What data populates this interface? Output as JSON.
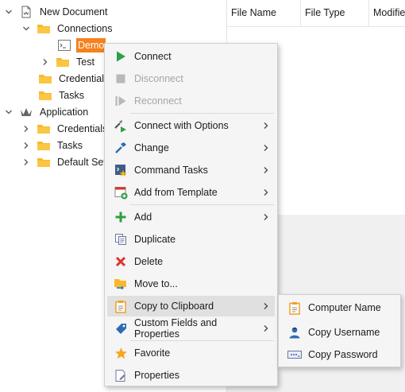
{
  "tree": {
    "items": [
      {
        "label": "New Document"
      },
      {
        "label": "Connections"
      },
      {
        "label": "Demo"
      },
      {
        "label": "Test"
      },
      {
        "label": "Credentials"
      },
      {
        "label": "Tasks"
      },
      {
        "label": "Application"
      },
      {
        "label": "Credentials"
      },
      {
        "label": "Tasks"
      },
      {
        "label": "Default Set"
      }
    ]
  },
  "grid": {
    "columns": [
      "File Name",
      "File Type",
      "Modifie"
    ]
  },
  "context_menu": {
    "items": [
      {
        "label": "Connect",
        "icon": "play-icon",
        "enabled": true
      },
      {
        "label": "Disconnect",
        "icon": "stop-icon",
        "enabled": false
      },
      {
        "label": "Reconnect",
        "icon": "reconnect-icon",
        "enabled": false
      },
      {
        "label": "Connect with Options",
        "icon": "connect-options-icon",
        "submenu": true
      },
      {
        "label": "Change",
        "icon": "hammer-icon",
        "submenu": true
      },
      {
        "label": "Command Tasks",
        "icon": "command-tasks-icon",
        "submenu": true
      },
      {
        "label": "Add from Template",
        "icon": "template-icon",
        "submenu": true
      },
      {
        "label": "Add",
        "icon": "plus-icon",
        "submenu": true
      },
      {
        "label": "Duplicate",
        "icon": "duplicate-icon"
      },
      {
        "label": "Delete",
        "icon": "delete-icon"
      },
      {
        "label": "Move to...",
        "icon": "move-folder-icon"
      },
      {
        "label": "Copy to Clipboard",
        "icon": "clipboard-icon",
        "submenu": true,
        "highlighted": true
      },
      {
        "label": "Custom Fields and Properties",
        "icon": "tag-icon",
        "submenu": true
      },
      {
        "label": "Favorite",
        "icon": "star-icon"
      },
      {
        "label": "Properties",
        "icon": "properties-icon"
      }
    ]
  },
  "submenu": {
    "items": [
      {
        "label": "Computer Name",
        "icon": "clipboard-icon"
      },
      {
        "label": "Copy  Username",
        "icon": "user-icon"
      },
      {
        "label": "Copy  Password",
        "icon": "password-icon"
      }
    ]
  },
  "colors": {
    "selection": "#f5811f",
    "folder": "#f7b92b",
    "menu_bg": "#f5f5f5",
    "menu_hover": "#e0e0e0"
  }
}
